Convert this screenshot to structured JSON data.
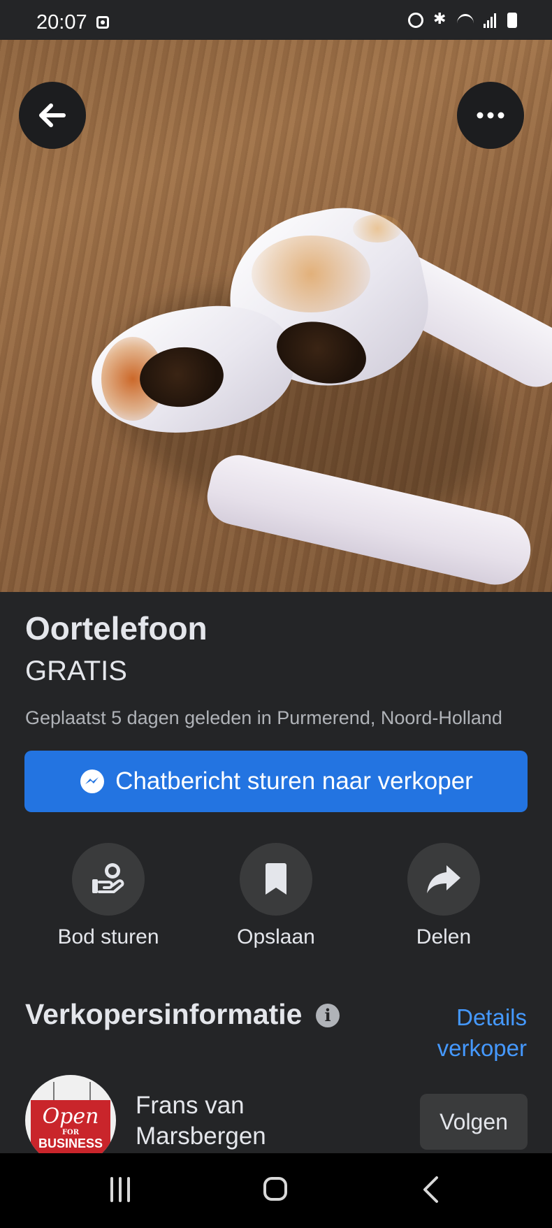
{
  "status_bar": {
    "time": "20:07",
    "icons": [
      "notification-icon",
      "alarm-icon",
      "bluetooth-icon",
      "wifi-icon",
      "signal-icon",
      "battery-icon"
    ]
  },
  "listing": {
    "image_alt": "Oortelefoon",
    "title": "Oortelefoon",
    "price": "GRATIS",
    "meta": "Geplaatst 5 dagen geleden in Purmerend, Noord-Holland",
    "chat_button": "Chatbericht sturen naar verkoper"
  },
  "actions": [
    {
      "label": "Bod sturen",
      "icon": "offer-icon"
    },
    {
      "label": "Opslaan",
      "icon": "bookmark-icon"
    },
    {
      "label": "Delen",
      "icon": "share-icon"
    }
  ],
  "seller": {
    "heading": "Verkopersinformatie",
    "details_link": "Details verkoper",
    "name": "Frans van Marsbergen",
    "follow_button": "Volgen",
    "avatar_sign": {
      "open": "Open",
      "for": "FOR",
      "business": "BUSINESS"
    }
  },
  "colors": {
    "background": "#242527",
    "accent": "#2374e1",
    "link": "#4599ff",
    "secondary_button": "#3a3b3c"
  }
}
